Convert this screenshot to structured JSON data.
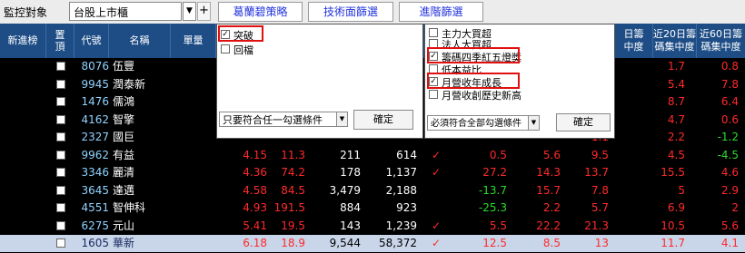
{
  "topbar": {
    "monitor_label": "監控對象",
    "market_value": "台股上市櫃",
    "add_symbol": "+",
    "tabs": [
      "葛蘭碧策略",
      "技術面篩選",
      "進階篩選"
    ]
  },
  "header": {
    "columns": [
      "新進榜",
      "置頂",
      "代號",
      "名稱",
      "單量",
      "",
      "",
      "",
      "",
      "",
      "",
      "日籌碼集中度",
      "近20日籌碼集中度",
      "近60日籌碼集中度"
    ],
    "col_top_fragments": [
      "日籌",
      "近20日籌",
      "近60日籌"
    ],
    "col_bottom_fragments": [
      "中度",
      "碼集中度",
      "碼集中度"
    ]
  },
  "colors": {
    "header_bg": "#1e4d86",
    "up": "#ff2a2a",
    "down": "#2adc2a",
    "code": "#8fd3ff",
    "name": "#ffffff",
    "highlight_row": "#c9d6ea"
  },
  "rows": [
    {
      "code": "8076",
      "name": "伍豐",
      "c1": "",
      "c2": "",
      "c3": "",
      "c4": "",
      "check": false,
      "v1": "",
      "v2": "",
      "v3": "1.5",
      "v4": "1.7",
      "v5": "0.8",
      "v5_color": "up"
    },
    {
      "code": "9945",
      "name": "潤泰新",
      "c1": "",
      "c2": "",
      "c3": "",
      "c4": "",
      "check": false,
      "v1": "",
      "v2": "",
      "v3": "0.5",
      "v4": "5.4",
      "v5": "7.8",
      "v5_color": "up"
    },
    {
      "code": "1476",
      "name": "儒鴻",
      "c1": "",
      "c2": "",
      "c3": "",
      "c4": "",
      "check": false,
      "v1": "",
      "v2": "",
      "v3": "4.4",
      "v4": "8.7",
      "v5": "6.4",
      "v5_color": "up"
    },
    {
      "code": "4162",
      "name": "智擎",
      "c1": "",
      "c2": "",
      "c3": "",
      "c4": "",
      "check": false,
      "v1": "",
      "v2": "",
      "v3": "0.2",
      "v4": "4.7",
      "v5": "0.6",
      "v5_color": "up"
    },
    {
      "code": "2327",
      "name": "國巨",
      "c1": "",
      "c2": "",
      "c3": "",
      "c4": "",
      "check": false,
      "v1": "",
      "v2": "",
      "v3": "1.1",
      "v4": "2.2",
      "v5": "-1.2",
      "v5_color": "down"
    },
    {
      "code": "9962",
      "name": "有益",
      "c1": "4.15",
      "c2": "11.3",
      "c3": "211",
      "c4": "614",
      "check": true,
      "v1": "0.5",
      "v2": "5.6",
      "v3": "9.5",
      "v4": "4.5",
      "v5": "-4.5",
      "v1_color": "up",
      "v5_color": "down"
    },
    {
      "code": "3346",
      "name": "麗清",
      "c1": "4.36",
      "c2": "74.2",
      "c3": "178",
      "c4": "1,137",
      "check": true,
      "v1": "27.2",
      "v2": "14.3",
      "v3": "13.7",
      "v4": "15.5",
      "v5": "4.6",
      "v1_color": "up",
      "v5_color": "up"
    },
    {
      "code": "3645",
      "name": "達邁",
      "c1": "4.58",
      "c2": "84.5",
      "c3": "3,479",
      "c4": "2,188",
      "check": false,
      "v1": "-13.7",
      "v2": "15.7",
      "v3": "7.8",
      "v4": "5",
      "v5": "2.9",
      "v1_color": "down",
      "v5_color": "up"
    },
    {
      "code": "4551",
      "name": "智伸科",
      "c1": "4.93",
      "c2": "191.5",
      "c3": "884",
      "c4": "923",
      "check": false,
      "v1": "-25.3",
      "v2": "2.2",
      "v3": "5.7",
      "v4": "6.9",
      "v5": "2",
      "v1_color": "down",
      "v5_color": "up"
    },
    {
      "code": "6275",
      "name": "元山",
      "c1": "5.41",
      "c2": "19.5",
      "c3": "143",
      "c4": "1,239",
      "check": true,
      "v1": "5.5",
      "v2": "22.2",
      "v3": "21.3",
      "v4": "10.5",
      "v5": "5.6",
      "v1_color": "up",
      "v5_color": "up"
    },
    {
      "code": "1605",
      "name": "華新",
      "c1": "6.18",
      "c2": "18.9",
      "c3": "9,544",
      "c4": "58,372",
      "check": true,
      "v1": "12.5",
      "v2": "8.5",
      "v3": "13",
      "v4": "11.7",
      "v5": "4.1",
      "v1_color": "up",
      "v5_color": "up"
    }
  ],
  "popup_left": {
    "items": [
      {
        "label": "突破",
        "checked": true
      },
      {
        "label": "回檔",
        "checked": false
      }
    ],
    "condition_select": "只要符合任一勾選條件",
    "confirm_label": "確定"
  },
  "popup_right": {
    "items": [
      {
        "label": "主力大買超",
        "checked": false
      },
      {
        "label": "法人大買超",
        "checked": false
      },
      {
        "label": "籌碼四季紅五燈獎",
        "checked": true
      },
      {
        "label": "低本益比",
        "checked": false
      },
      {
        "label": "月營收年成長",
        "checked": true
      },
      {
        "label": "月營收創歷史新高",
        "checked": false
      }
    ],
    "condition_select": "必須符合全部勾選條件",
    "confirm_label": "確定"
  },
  "icons": {
    "checkmark": "check-icon",
    "dropdown": "chevron-down-icon"
  }
}
